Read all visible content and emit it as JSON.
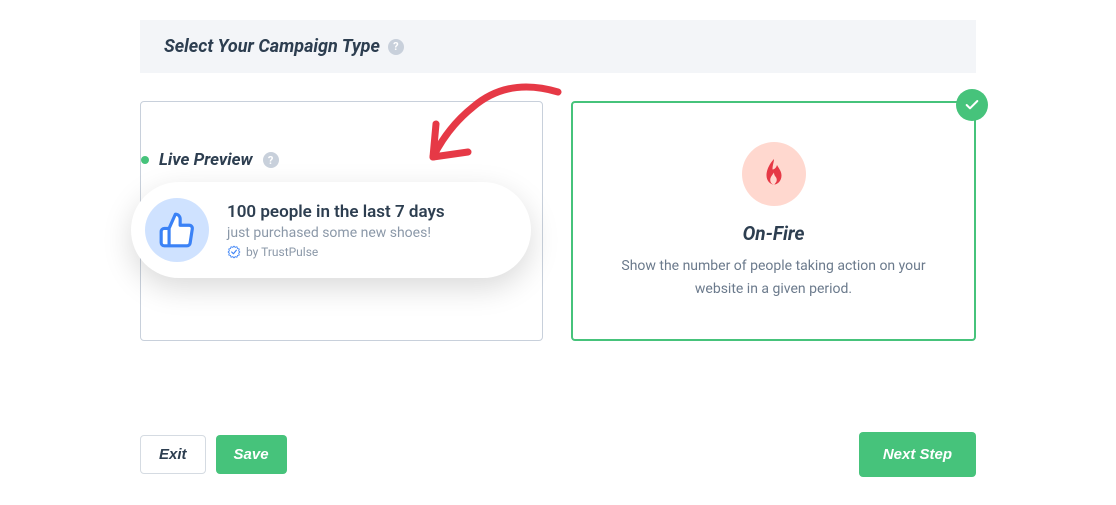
{
  "header": {
    "title": "Select Your Campaign Type"
  },
  "live_preview": {
    "header": "Live Preview",
    "notification_title": "100 people in the last 7 days",
    "notification_sub": "just purchased some new shoes!",
    "brand": "by TrustPulse"
  },
  "cards": {
    "on_fire": {
      "title": "On-Fire",
      "desc": "Show the number of people taking action on your website in a given period."
    }
  },
  "footer": {
    "exit": "Exit",
    "save": "Save",
    "next": "Next Step"
  }
}
